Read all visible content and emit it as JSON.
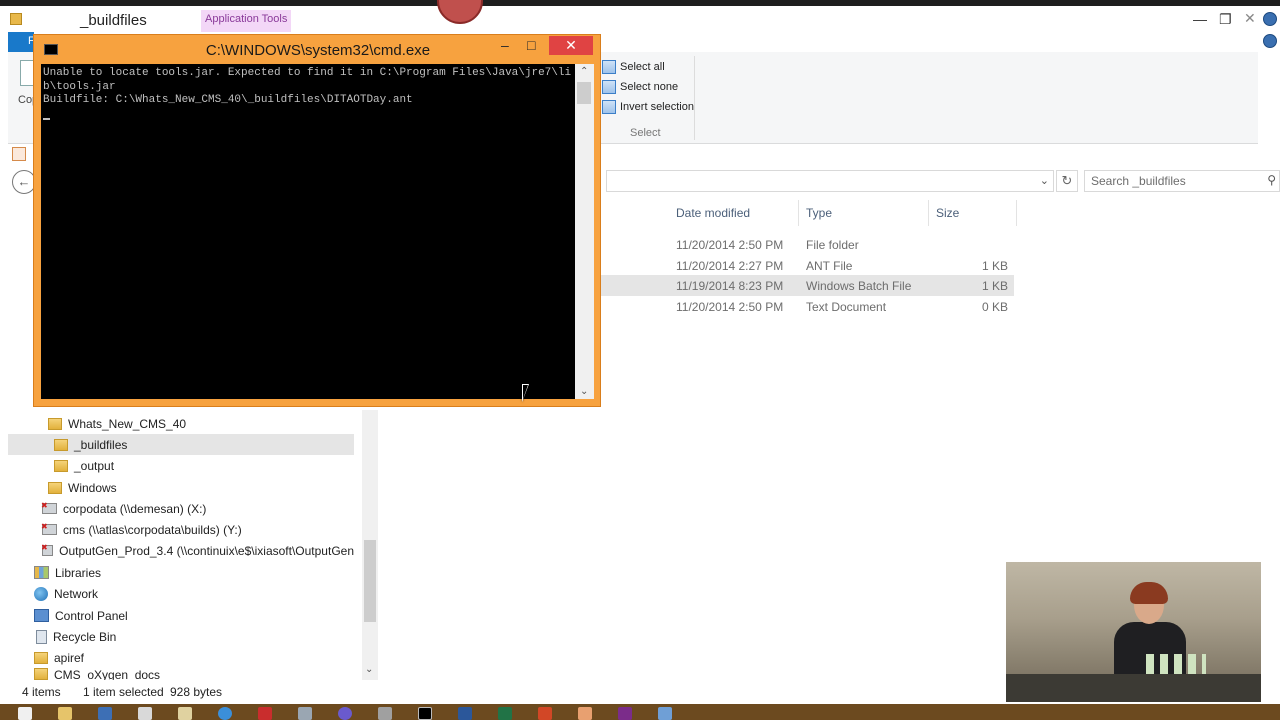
{
  "explorer": {
    "title": "_buildfiles",
    "context_tab": "Application Tools",
    "file_tab": "F",
    "ribbon": {
      "copy_label": "Cop",
      "select_all": "Select all",
      "select_none": "Select none",
      "invert_selection": "Invert selection",
      "select_group": "Select"
    },
    "search_placeholder": "Search _buildfiles",
    "columns": [
      "Date modified",
      "Type",
      "Size"
    ],
    "files": [
      {
        "date": "11/20/2014 2:50 PM",
        "type": "File folder",
        "size": ""
      },
      {
        "date": "11/20/2014 2:27 PM",
        "type": "ANT File",
        "size": "1 KB"
      },
      {
        "date": "11/19/2014 8:23 PM",
        "type": "Windows Batch File",
        "size": "1 KB",
        "selected": true
      },
      {
        "date": "11/20/2014 2:50 PM",
        "type": "Text Document",
        "size": "0 KB"
      }
    ],
    "nav": [
      {
        "label": "Whats_New_CMS_40",
        "icon": "folder-icon"
      },
      {
        "label": "_buildfiles",
        "icon": "folder-icon",
        "selected": true
      },
      {
        "label": "_output",
        "icon": "folder-icon"
      },
      {
        "label": "Windows",
        "icon": "folder-icon"
      },
      {
        "label": "corpodata (\\\\demesan) (X:)",
        "icon": "disconnected-drive-icon"
      },
      {
        "label": "cms (\\\\atlas\\corpodata\\builds) (Y:)",
        "icon": "disconnected-drive-icon"
      },
      {
        "label": "OutputGen_Prod_3.4 (\\\\continuix\\e$\\ixiasoft\\OutputGen",
        "icon": "disconnected-drive-icon"
      },
      {
        "label": "Libraries",
        "icon": "libraries-icon"
      },
      {
        "label": "Network",
        "icon": "network-icon"
      },
      {
        "label": "Control Panel",
        "icon": "control-panel-icon"
      },
      {
        "label": "Recycle Bin",
        "icon": "recycle-bin-icon"
      },
      {
        "label": "apiref",
        "icon": "folder-icon"
      },
      {
        "label": "CMS_oXygen_docs",
        "icon": "folder-icon"
      }
    ],
    "status": {
      "items": "4 items",
      "selection": "1 item selected",
      "size": "928 bytes"
    }
  },
  "console": {
    "title": "C:\\WINDOWS\\system32\\cmd.exe",
    "lines": [
      "Unable to locate tools.jar. Expected to find it in C:\\Program Files\\Java\\jre7\\li",
      "b\\tools.jar",
      "Buildfile: C:\\Whats_New_CMS_40\\_buildfiles\\DITAOTDay.ant"
    ],
    "minimize": "–",
    "maximize": "□",
    "close": "✕"
  },
  "colors": {
    "console_frame": "#f7a23f",
    "console_close": "#e04343",
    "file_tab": "#1979ca",
    "context_tab_bg": "#f3d7f7",
    "taskbar": "#6c4a1f"
  }
}
